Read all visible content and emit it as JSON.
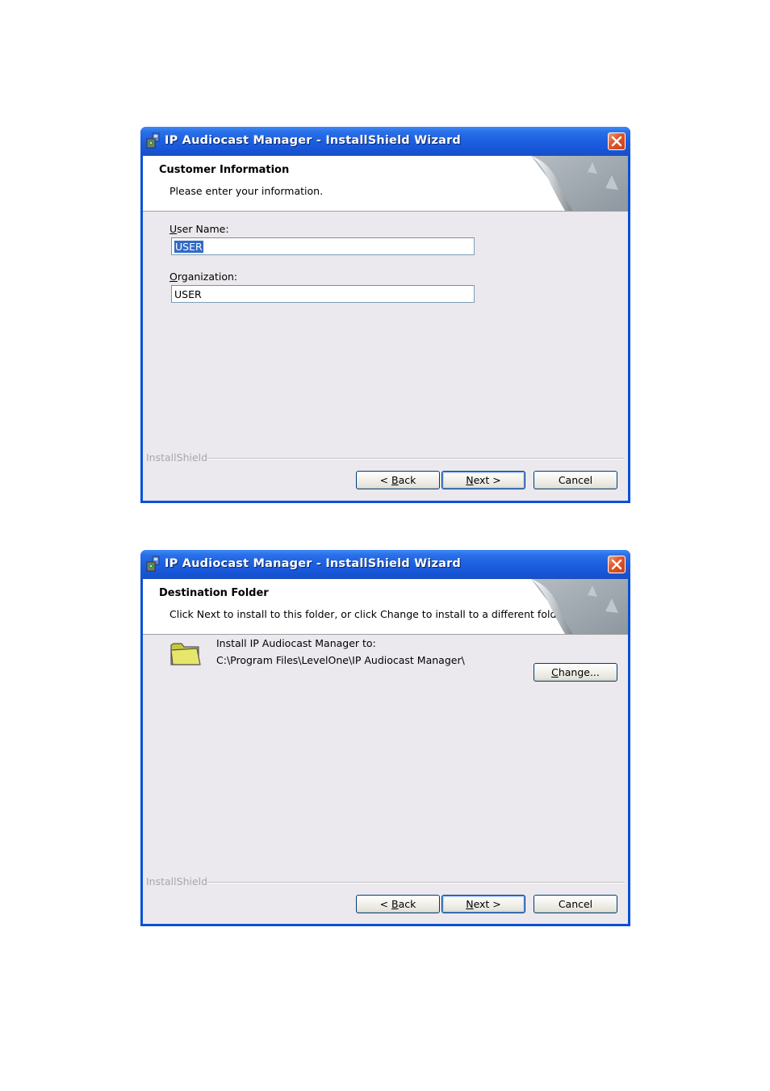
{
  "dialogs": [
    {
      "title": "IP Audiocast Manager - InstallShield Wizard",
      "banner_title": "Customer Information",
      "banner_subtitle": "Please enter your information.",
      "fields": [
        {
          "label_accel": "U",
          "label_rest": "ser Name:",
          "value": "USER",
          "selected": true
        },
        {
          "label_accel": "O",
          "label_rest": "rganization:",
          "value": "USER",
          "selected": false
        }
      ],
      "brand": "InstallShield",
      "buttons": {
        "back_prefix": "< ",
        "back_accel": "B",
        "back_rest": "ack",
        "next_accel": "N",
        "next_rest": "ext >",
        "cancel": "Cancel"
      }
    },
    {
      "title": "IP Audiocast Manager - InstallShield Wizard",
      "banner_title": "Destination Folder",
      "banner_subtitle": "Click Next to install to this folder, or click Change to install to a different folder.",
      "install_label": "Install IP Audiocast Manager to:",
      "install_path": "C:\\Program Files\\LevelOne\\IP Audiocast Manager\\",
      "change_accel": "C",
      "change_rest": "hange...",
      "brand": "InstallShield",
      "buttons": {
        "back_prefix": "< ",
        "back_accel": "B",
        "back_rest": "ack",
        "next_accel": "N",
        "next_rest": "ext >",
        "cancel": "Cancel"
      }
    }
  ],
  "icons": {
    "app": "installer-package-icon",
    "close": "close-x-icon",
    "folder": "folder-icon"
  }
}
